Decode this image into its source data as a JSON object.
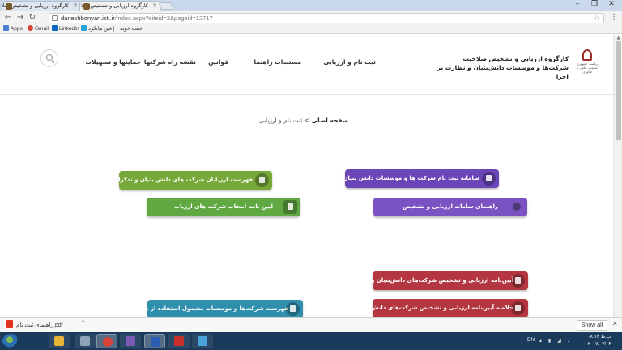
{
  "browser": {
    "tabs": [
      {
        "title": "کارگروه ارزیابی و تشخیص صلا",
        "active": false
      },
      {
        "title": "کارگروه ارزیابی و تشخیص صلا",
        "active": true
      }
    ],
    "address": {
      "host": "daneshbonyan.isti.ir",
      "path": "/index.aspx?siteid=2&pageid=12717"
    },
    "bookmarks": [
      {
        "label": "Apps",
        "icon": "apps-grid-icon",
        "color": "#4a7fd4"
      },
      {
        "label": "Gmail",
        "icon": "google-icon",
        "color": "#db4437"
      },
      {
        "label": "LinkedIn",
        "icon": "linkedin-icon",
        "color": "#0a66c2"
      },
      {
        "label": "فین هانکرد |",
        "icon": "generic-site-icon",
        "color": "#2aa6d8"
      },
      {
        "label": "عقب خوبه",
        "icon": "",
        "color": ""
      }
    ],
    "window_buttons": [
      "–",
      "❐",
      "✕"
    ]
  },
  "site": {
    "emblem_caption": "ریاست جمهوری معاونت علمی و فناوری",
    "title_line1": "کارگروه ارزیابی و تشخیص صلاحیت",
    "title_line2": "شرکت‌ها و موسسات دانش‌بنیان و نظارت بر اجرا",
    "nav": [
      "ثبت نام و ارزیابی",
      "مستندات راهنما",
      "قوانین",
      "نقشه راه شرکتها",
      "حمایتها و تسهیلات"
    ]
  },
  "breadcrumb": {
    "home": "صفحه اصلی",
    "separator": " > ",
    "current": "ثبت نام و ارزیابی"
  },
  "tiles": [
    {
      "label": "سامانه ثبت نام شرکت ها و موسسات دانش بنیان",
      "color": "#6a46b8",
      "icon": "user-badge-icon"
    },
    {
      "label": "فهرست ارزیابان شرکت های دانش بنیان و تذکرات لازم",
      "color": "#76a83a",
      "icon": "search-icon"
    },
    {
      "label": "راهنمای سامانه ارزیابی و تشخیص",
      "color": "#7a52c2",
      "icon": "team-icon"
    },
    {
      "label": "آیین نامه انتخاب شرکت های ارزیاب",
      "color": "#5fa842",
      "icon": "document-icon"
    },
    {
      "label": "آیین‌نامه ارزیابی و تشخیص شرکت‌های دانش‌بنیان و پیوست‌ها",
      "color": "#b33640",
      "icon": "book-icon"
    },
    {
      "label": "فهرست شرکت‌ها و موسسات مشمول استفاده از مزایای قانون",
      "color": "#2f8fad",
      "icon": "list-icon"
    },
    {
      "label": "خلاصه آیین‌نامه ارزیابی و تشخیص شرکت‌های دانش‌بنیان",
      "color": "#b33640",
      "icon": "book-icon"
    }
  ],
  "download_shelf": {
    "file": "راهنمای ثبت نام.pdf",
    "show_all": "Show all"
  },
  "taskbar": {
    "apps": [
      {
        "name": "explorer",
        "color": "#e8b43a"
      },
      {
        "name": "chrome",
        "color": "#d9443a"
      },
      {
        "name": "visual-studio",
        "color": "#7a5bb8"
      },
      {
        "name": "word",
        "color": "#2b5fb4"
      },
      {
        "name": "acrobat",
        "color": "#c9302c"
      },
      {
        "name": "paint",
        "color": "#4aa3d8"
      }
    ],
    "lang": "EN",
    "time": "ب.ظ ۰۸:۱۲",
    "date": "۲۰۱۷/۰۳/۰۳"
  }
}
